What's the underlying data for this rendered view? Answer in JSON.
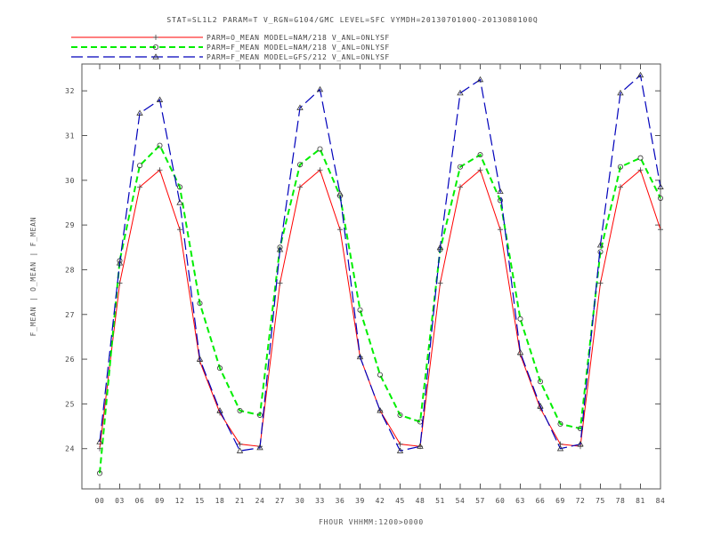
{
  "chart_data": {
    "type": "line",
    "title": "STAT=SL1L2 PARAM=T V_RGN=G104/GMC LEVEL=SFC VYMDH=2013070100Q-2013080100Q",
    "xlabel": "FHOUR VHHMM:1200>0000",
    "ylabel": "F_MEAN | O_MEAN | F_MEAN",
    "ylim": [
      23.1,
      32.6
    ],
    "yticks": [
      "24",
      "25",
      "26",
      "27",
      "28",
      "29",
      "30",
      "31",
      "32"
    ],
    "categories": [
      "00",
      "03",
      "06",
      "09",
      "12",
      "15",
      "18",
      "21",
      "24",
      "27",
      "30",
      "33",
      "36",
      "39",
      "42",
      "45",
      "48",
      "51",
      "54",
      "57",
      "60",
      "63",
      "66",
      "69",
      "72",
      "75",
      "78",
      "81",
      "84"
    ],
    "grid": false,
    "legend_position": "top-left",
    "series": [
      {
        "name": "PARM=O_MEAN MODEL=NAM/218 V_ANL=ONLYSF",
        "color": "#ff0000",
        "dash": "solid",
        "marker": "+",
        "values": [
          24.0,
          27.7,
          29.85,
          30.23,
          28.9,
          25.95,
          24.8,
          24.1,
          24.05,
          27.7,
          29.85,
          30.23,
          28.9,
          26.05,
          24.85,
          24.1,
          24.05,
          27.7,
          29.85,
          30.23,
          28.9,
          26.1,
          24.9,
          24.1,
          24.05,
          27.7,
          29.85,
          30.23,
          28.9
        ]
      },
      {
        "name": "PARM=F_MEAN MODEL=NAM/218 V_ANL=ONLYSF",
        "color": "#00ee00",
        "dash": "dashed",
        "marker": "o",
        "values": [
          23.45,
          28.2,
          30.33,
          30.78,
          29.85,
          27.25,
          25.8,
          24.85,
          24.75,
          28.5,
          30.35,
          30.7,
          29.65,
          27.1,
          25.65,
          24.75,
          24.6,
          28.45,
          30.3,
          30.57,
          29.55,
          26.9,
          25.5,
          24.55,
          24.45,
          28.4,
          30.3,
          30.5,
          29.6
        ]
      },
      {
        "name": "PARM=F_MEAN MODEL=GFS/212 V_ANL=ONLYSF",
        "color": "#0000bb",
        "dash": "longdash",
        "marker": "^",
        "values": [
          24.15,
          28.15,
          31.5,
          31.8,
          29.5,
          26.0,
          24.85,
          23.95,
          24.02,
          28.45,
          31.62,
          32.03,
          29.7,
          26.05,
          24.85,
          23.95,
          24.05,
          28.5,
          31.95,
          32.25,
          29.75,
          26.15,
          24.95,
          24.0,
          24.1,
          28.55,
          31.95,
          32.35,
          29.85
        ]
      }
    ]
  }
}
